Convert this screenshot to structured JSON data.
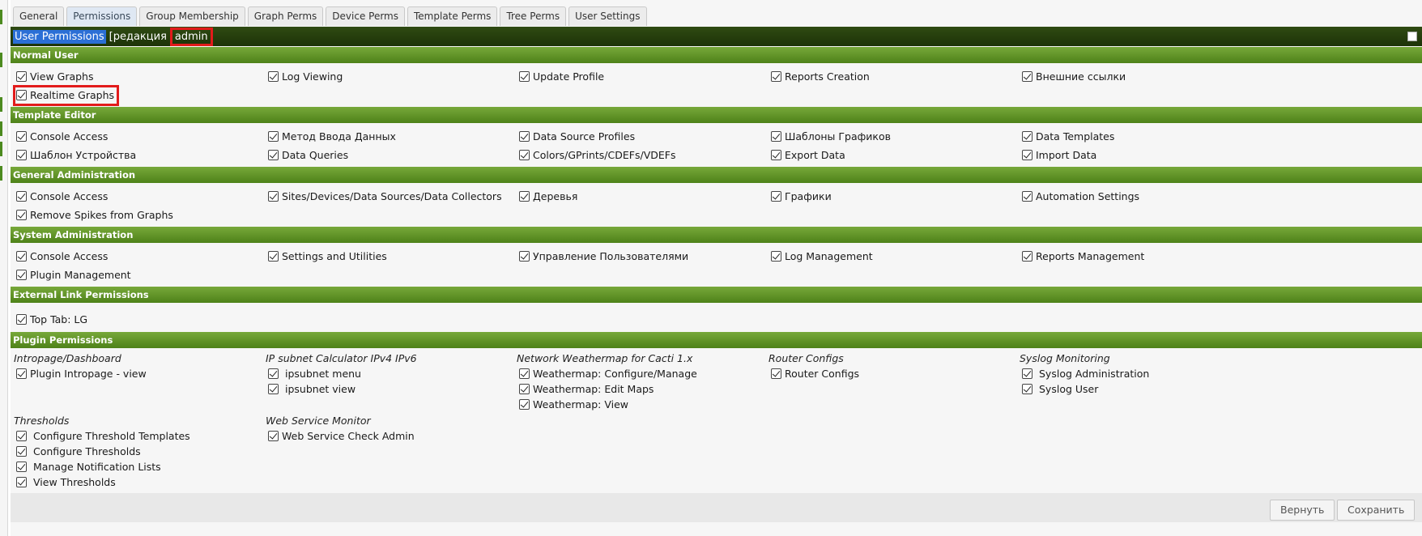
{
  "tabs": [
    "General",
    "Permissions",
    "Group Membership",
    "Graph Perms",
    "Device Perms",
    "Template Perms",
    "Tree Perms",
    "User Settings"
  ],
  "title": {
    "selected": "User Permissions",
    "rest": "[редакция",
    "user": "admin"
  },
  "sections": {
    "normal_user": {
      "label": "Normal User",
      "items": [
        "View Graphs",
        "Log Viewing",
        "Update Profile",
        "Reports Creation",
        "Внешние ссылки",
        "Realtime Graphs"
      ]
    },
    "template_editor": {
      "label": "Template Editor",
      "items": [
        "Console Access",
        "Метод Ввода Данных",
        "Data Source Profiles",
        "Шаблоны Графиков",
        "Data Templates",
        "Шаблон Устройства",
        "Data Queries",
        "Colors/GPrints/CDEFs/VDEFs",
        "Export Data",
        "Import Data"
      ]
    },
    "general_admin": {
      "label": "General Administration",
      "items": [
        "Console Access",
        "Sites/Devices/Data Sources/Data Collectors",
        "Деревья",
        "Графики",
        "Automation Settings",
        "Remove Spikes from Graphs"
      ]
    },
    "system_admin": {
      "label": "System Administration",
      "items": [
        "Console Access",
        "Settings and Utilities",
        "Управление Пользователями",
        "Log Management",
        "Reports Management",
        "Plugin Management"
      ]
    },
    "external_link": {
      "label": "External Link Permissions",
      "items": [
        "Top Tab: LG"
      ]
    },
    "plugin": {
      "label": "Plugin Permissions",
      "groups": [
        {
          "title": "Intropage/Dashboard",
          "items": [
            "Plugin Intropage - view"
          ]
        },
        {
          "title": "IP subnet Calculator IPv4 IPv6",
          "items": [
            "ipsubnet menu",
            "ipsubnet view"
          ]
        },
        {
          "title": "Network Weathermap for Cacti 1.x",
          "items": [
            "Weathermap: Configure/Manage",
            "Weathermap: Edit Maps",
            "Weathermap: View"
          ]
        },
        {
          "title": "Router Configs",
          "items": [
            "Router Configs"
          ]
        },
        {
          "title": "Syslog Monitoring",
          "items": [
            "Syslog Administration",
            "Syslog User"
          ]
        },
        {
          "title": "Thresholds",
          "items": [
            "Configure Threshold Templates",
            "Configure Thresholds",
            "Manage Notification Lists",
            "View Thresholds"
          ]
        },
        {
          "title": "Web Service Monitor",
          "items": [
            "Web Service Check Admin"
          ]
        }
      ]
    }
  },
  "buttons": {
    "revert": "Вернуть",
    "save": "Сохранить"
  },
  "colors": {
    "header_green": "#5b8f22",
    "title_dark": "#25400d",
    "selection_blue": "#2b6fd6",
    "highlight_red": "#e21b1b"
  }
}
